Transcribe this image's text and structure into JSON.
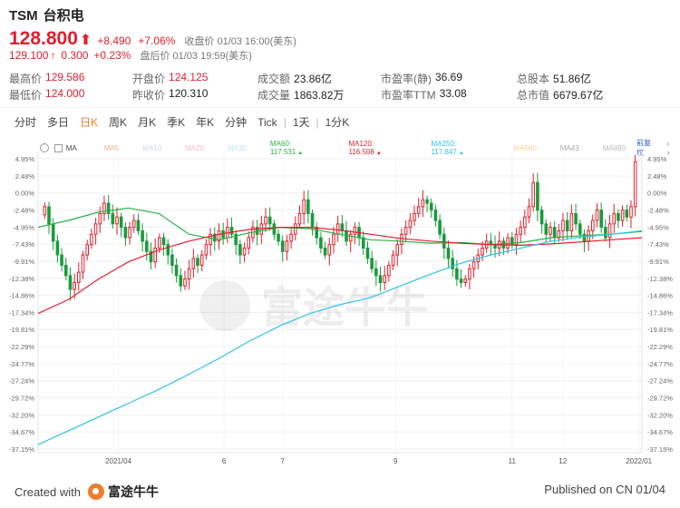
{
  "header": {
    "ticker": "TSM",
    "name": "台积电",
    "price": "128.800",
    "change": "+8.490",
    "change_pct": "+7.06%",
    "close_label": "收盘价 01/03 16:00(美东)",
    "after_price": "129.100",
    "after_change": "0.300",
    "after_pct": "+0.23%",
    "after_label": "盘后价 01/03 19:59(美东)"
  },
  "stats": {
    "rows": [
      [
        {
          "label": "最高价",
          "value": "129.586",
          "tone": "red"
        },
        {
          "label": "开盘价",
          "value": "124.125",
          "tone": "red"
        },
        {
          "label": "成交额",
          "value": "23.86亿",
          "tone": ""
        },
        {
          "label": "市盈率(静)",
          "value": "36.69",
          "tone": ""
        },
        {
          "label": "总股本",
          "value": "51.86亿",
          "tone": ""
        }
      ],
      [
        {
          "label": "最低价",
          "value": "124.000",
          "tone": "red"
        },
        {
          "label": "昨收价",
          "value": "120.310",
          "tone": ""
        },
        {
          "label": "成交量",
          "value": "1863.82万",
          "tone": ""
        },
        {
          "label": "市盈率TTM",
          "value": "33.08",
          "tone": ""
        },
        {
          "label": "总市值",
          "value": "6679.67亿",
          "tone": ""
        }
      ]
    ]
  },
  "tabs": [
    "分时",
    "多日",
    "日K",
    "周K",
    "月K",
    "季K",
    "年K",
    "分钟",
    "Tick"
  ],
  "active_tab": "日K",
  "period_control": "1天",
  "minute_control": "1分K",
  "ma_legend": {
    "label": "MA",
    "items": [
      {
        "text": "MA5",
        "color": "#f4b08a"
      },
      {
        "text": "MA10",
        "color": "#c9d7f5"
      },
      {
        "text": "MA20",
        "color": "#f7b8c8"
      },
      {
        "text": "MA30",
        "color": "#c5e3f0"
      },
      {
        "text": "MA60: 117.531",
        "color": "#2bb04a",
        "tri": "▲"
      },
      {
        "text": "MA120: 116.508",
        "color": "#e0202e",
        "tri": "▲"
      },
      {
        "text": "MA250: 117.847",
        "color": "#2ec4e6",
        "tri": "▲"
      },
      {
        "text": "MA500",
        "color": "#f6d18f"
      },
      {
        "text": "MA43",
        "color": "#aaaaaa"
      },
      {
        "text": "MA880",
        "color": "#bbbbbb"
      }
    ],
    "adjust_label": "前复权"
  },
  "watermark": "富途牛牛",
  "footer": {
    "created_with": "Created with",
    "brand": "富途牛牛",
    "published": "Published on CN 01/04"
  },
  "colors": {
    "up": "#e0202e",
    "down": "#1a9a3c",
    "accent": "#f07d2a"
  },
  "chart_data": {
    "type": "candlestick",
    "y_axis_ticks": [
      "4.95%",
      "2.48%",
      "0.00%",
      "-2.48%",
      "-4.95%",
      "-7.43%",
      "-9.91%",
      "-12.38%",
      "-14.86%",
      "-17.34%",
      "-19.81%",
      "-22.29%",
      "-24.77%",
      "-27.24%",
      "-29.72%",
      "-32.20%",
      "-34.67%",
      "-37.15%"
    ],
    "ylim": [
      -37.15,
      4.95
    ],
    "x_labels": [
      {
        "label": "2021/04",
        "pos": 0.133
      },
      {
        "label": "6",
        "pos": 0.308
      },
      {
        "label": "7",
        "pos": 0.405
      },
      {
        "label": "9",
        "pos": 0.592
      },
      {
        "label": "11",
        "pos": 0.785
      },
      {
        "label": "12",
        "pos": 0.869
      },
      {
        "label": "2022/01",
        "pos": 0.995
      }
    ],
    "close_pct": [
      -2.0,
      -4.5,
      -7.0,
      -9.0,
      -10.5,
      -12.0,
      -14.0,
      -13.0,
      -11.5,
      -9.0,
      -7.5,
      -6.0,
      -4.5,
      -3.0,
      -1.5,
      -3.0,
      -4.5,
      -3.5,
      -5.0,
      -6.5,
      -5.0,
      -4.0,
      -5.5,
      -7.0,
      -8.5,
      -10.0,
      -8.0,
      -6.5,
      -7.5,
      -9.0,
      -10.5,
      -12.0,
      -13.5,
      -12.5,
      -11.0,
      -9.5,
      -10.5,
      -9.0,
      -7.5,
      -6.0,
      -7.0,
      -5.5,
      -6.5,
      -5.0,
      -6.0,
      -7.5,
      -9.0,
      -8.0,
      -6.5,
      -5.0,
      -6.0,
      -4.5,
      -3.5,
      -4.5,
      -6.0,
      -7.0,
      -8.5,
      -7.0,
      -6.0,
      -4.5,
      -3.0,
      -1.0,
      -3.0,
      -5.0,
      -6.5,
      -8.0,
      -9.0,
      -7.5,
      -6.0,
      -4.5,
      -5.5,
      -7.0,
      -6.0,
      -5.0,
      -6.5,
      -8.0,
      -9.5,
      -11.0,
      -12.0,
      -13.0,
      -12.0,
      -10.5,
      -9.0,
      -7.5,
      -6.0,
      -5.0,
      -4.0,
      -3.0,
      -2.0,
      -1.0,
      -1.5,
      -2.5,
      -4.0,
      -6.0,
      -8.0,
      -9.5,
      -11.0,
      -12.5,
      -13.0,
      -12.5,
      -11.0,
      -10.0,
      -9.0,
      -8.0,
      -7.0,
      -7.5,
      -8.0,
      -7.0,
      -8.0,
      -6.5,
      -7.5,
      -6.0,
      -5.0,
      -3.5,
      -2.0,
      1.5,
      -2.5,
      -4.5,
      -6.0,
      -5.0,
      -6.5,
      -5.5,
      -4.0,
      -5.5,
      -3.0,
      -4.5,
      -6.0,
      -7.0,
      -5.5,
      -4.0,
      -2.5,
      -5.0,
      -6.5,
      -4.5,
      -3.0,
      -4.0,
      -2.5,
      -3.5,
      -2.0,
      4.5
    ],
    "series": [
      {
        "name": "MA60: 117.531",
        "color": "#2bb04a",
        "points": [
          [
            0,
            -5.0
          ],
          [
            0.05,
            -4.0
          ],
          [
            0.1,
            -2.8
          ],
          [
            0.15,
            -2.2
          ],
          [
            0.2,
            -3.0
          ],
          [
            0.25,
            -6.0
          ],
          [
            0.3,
            -6.8
          ],
          [
            0.35,
            -5.8
          ],
          [
            0.4,
            -5.0
          ],
          [
            0.45,
            -5.2
          ],
          [
            0.5,
            -6.0
          ],
          [
            0.55,
            -6.8
          ],
          [
            0.6,
            -7.0
          ],
          [
            0.65,
            -7.3
          ],
          [
            0.7,
            -7.2
          ],
          [
            0.75,
            -7.5
          ],
          [
            0.8,
            -7.2
          ],
          [
            0.85,
            -6.5
          ],
          [
            0.9,
            -6.2
          ],
          [
            0.95,
            -6.0
          ],
          [
            1.0,
            -5.6
          ]
        ]
      },
      {
        "name": "MA120: 116.508",
        "color": "#e0202e",
        "points": [
          [
            0,
            -17.5
          ],
          [
            0.05,
            -15.5
          ],
          [
            0.1,
            -12.5
          ],
          [
            0.15,
            -10.0
          ],
          [
            0.2,
            -8.3
          ],
          [
            0.25,
            -7.0
          ],
          [
            0.3,
            -6.0
          ],
          [
            0.35,
            -5.3
          ],
          [
            0.4,
            -5.0
          ],
          [
            0.45,
            -5.0
          ],
          [
            0.5,
            -5.4
          ],
          [
            0.55,
            -6.0
          ],
          [
            0.6,
            -6.6
          ],
          [
            0.65,
            -7.0
          ],
          [
            0.7,
            -7.3
          ],
          [
            0.75,
            -7.5
          ],
          [
            0.8,
            -7.6
          ],
          [
            0.85,
            -7.4
          ],
          [
            0.9,
            -7.1
          ],
          [
            0.95,
            -6.8
          ],
          [
            1.0,
            -6.5
          ]
        ]
      },
      {
        "name": "MA250: 117.847",
        "color": "#2ec4e6",
        "points": [
          [
            0,
            -36.5
          ],
          [
            0.05,
            -34.5
          ],
          [
            0.1,
            -32.5
          ],
          [
            0.15,
            -30.5
          ],
          [
            0.2,
            -28.5
          ],
          [
            0.25,
            -26.3
          ],
          [
            0.3,
            -24.0
          ],
          [
            0.35,
            -21.5
          ],
          [
            0.4,
            -19.3
          ],
          [
            0.45,
            -17.5
          ],
          [
            0.5,
            -16.2
          ],
          [
            0.55,
            -15.2
          ],
          [
            0.6,
            -13.5
          ],
          [
            0.65,
            -11.8
          ],
          [
            0.7,
            -10.2
          ],
          [
            0.75,
            -9.0
          ],
          [
            0.8,
            -8.0
          ],
          [
            0.85,
            -7.0
          ],
          [
            0.9,
            -6.4
          ],
          [
            0.95,
            -6.0
          ],
          [
            1.0,
            -5.5
          ]
        ]
      }
    ]
  }
}
